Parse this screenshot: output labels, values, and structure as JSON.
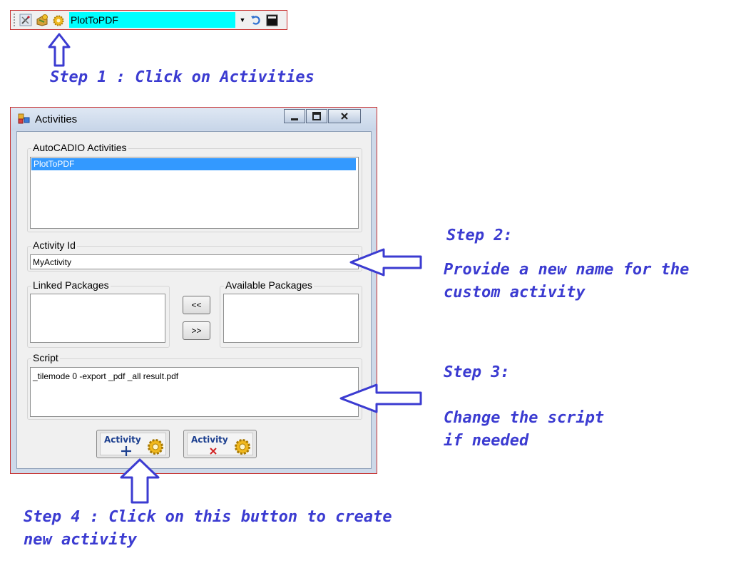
{
  "toolbar": {
    "selected_activity": "PlotToPDF",
    "icons": [
      "settings-tools-icon",
      "package-icon",
      "activities-gear-icon",
      "undo-icon",
      "console-icon"
    ]
  },
  "annotations": {
    "step1": "Step 1 : Click on Activities",
    "step2_title": "Step 2:",
    "step2_line1": "Provide a new name for the",
    "step2_line2": "custom activity",
    "step3_title": "Step 3:",
    "step3_line1": "Change the script",
    "step3_line2": "if needed",
    "step4_line1": "Step 4 : Click on this button to create",
    "step4_line2": "new activity"
  },
  "window": {
    "title": "Activities",
    "activities_group_label": "AutoCADIO Activities",
    "activities": [
      "PlotToPDF"
    ],
    "activity_id_label": "Activity Id",
    "activity_id_value": "MyActivity",
    "linked_packages_label": "Linked Packages",
    "available_packages_label": "Available Packages",
    "move_left_label": "<<",
    "move_right_label": ">>",
    "script_label": "Script",
    "script_value": "_tilemode 0 -export _pdf _all result.pdf",
    "create_button_label": "Activity",
    "delete_button_label": "Activity"
  },
  "colors": {
    "annotation": "#3b3bd1",
    "selection": "#3399ff",
    "combo": "#00ffff",
    "border_red": "#c8302f"
  }
}
